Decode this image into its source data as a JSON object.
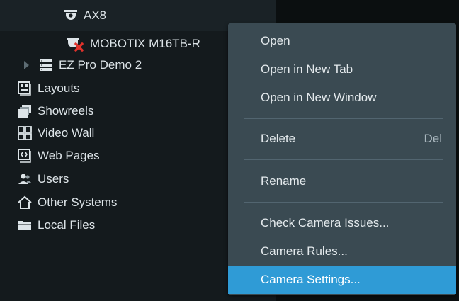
{
  "tree": {
    "items": [
      {
        "label": "AX8",
        "icon": "camera-icon"
      },
      {
        "label": "MOBOTIX M16TB-R",
        "icon": "camera-offline-icon"
      },
      {
        "label": "EZ Pro Demo 2",
        "icon": "server-icon"
      },
      {
        "label": "Layouts",
        "icon": "layouts-icon"
      },
      {
        "label": "Showreels",
        "icon": "showreels-icon"
      },
      {
        "label": "Video Wall",
        "icon": "video-wall-icon"
      },
      {
        "label": "Web Pages",
        "icon": "web-pages-icon"
      },
      {
        "label": "Users",
        "icon": "users-icon"
      },
      {
        "label": "Other Systems",
        "icon": "home-icon"
      },
      {
        "label": "Local Files",
        "icon": "folder-icon"
      }
    ]
  },
  "context_menu": {
    "open": "Open",
    "open_new_tab": "Open in New Tab",
    "open_new_window": "Open in New Window",
    "delete": "Delete",
    "delete_shortcut": "Del",
    "rename": "Rename",
    "check_issues": "Check Camera Issues...",
    "camera_rules": "Camera Rules...",
    "camera_settings": "Camera Settings..."
  },
  "colors": {
    "menu_bg": "#3a4a52",
    "selected_bg": "#2f9bd6",
    "offline_red": "#e0322b"
  }
}
